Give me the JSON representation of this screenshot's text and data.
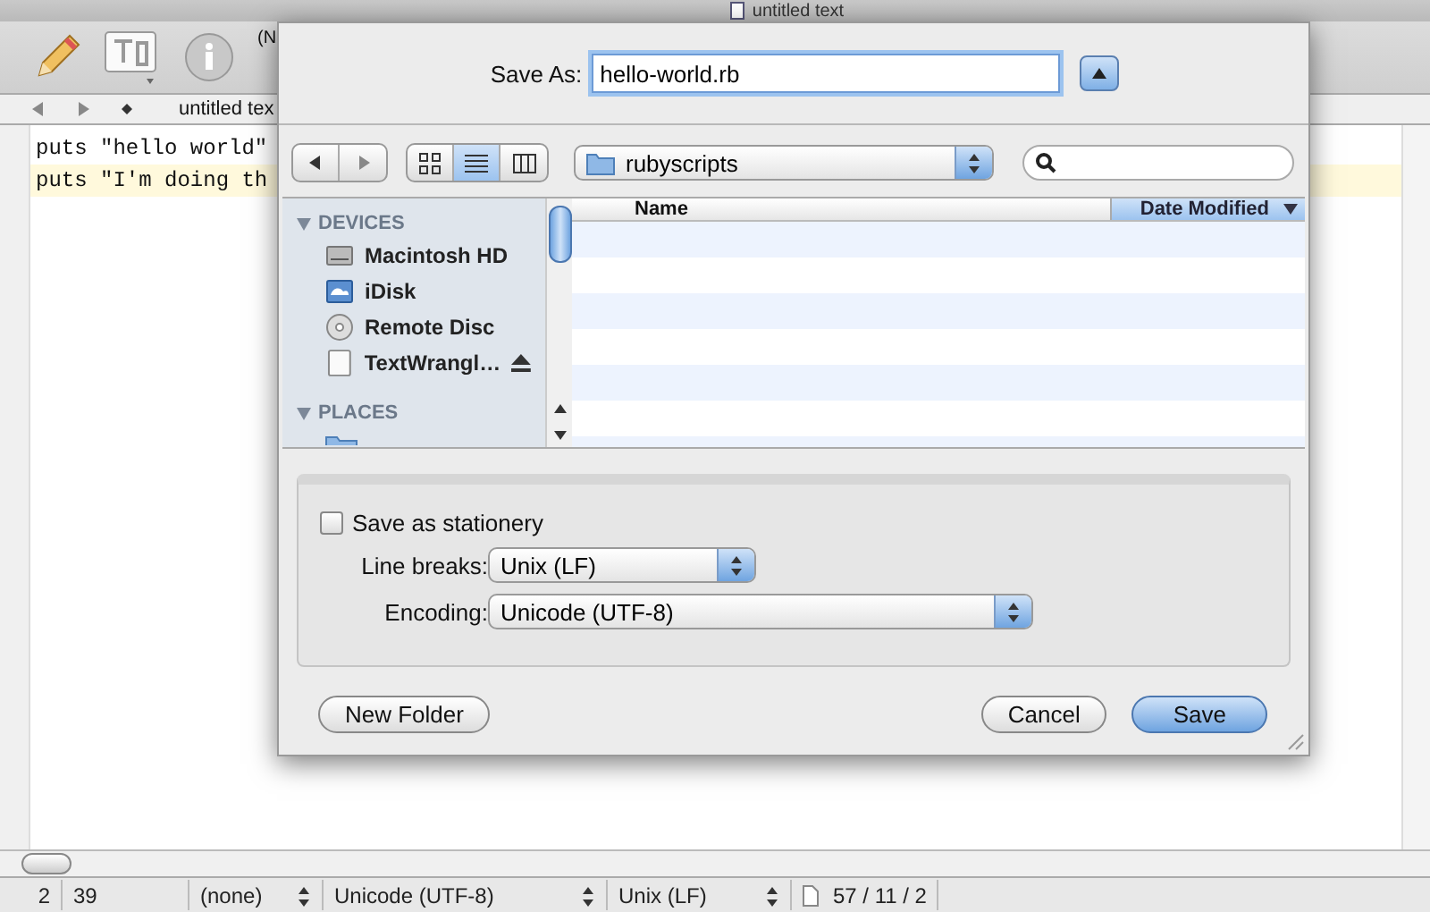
{
  "window": {
    "title": "untitled text",
    "document_label": "(N",
    "tab_title": "untitled tex",
    "lines": [
      {
        "text": "puts \"hello world\"",
        "current": false
      },
      {
        "text": "puts \"I'm doing th",
        "current": true
      }
    ]
  },
  "status_bar": {
    "line": "2",
    "column": "39",
    "language": "(none)",
    "encoding": "Unicode (UTF-8)",
    "line_breaks": "Unix (LF)",
    "counts": "57 / 11 / 2"
  },
  "save_sheet": {
    "save_as_label": "Save As:",
    "file_name": "hello-world.rb",
    "expanded": true,
    "view_modes": [
      {
        "kind": "icon",
        "selected": false
      },
      {
        "kind": "list",
        "selected": true
      },
      {
        "kind": "column",
        "selected": false
      }
    ],
    "location": "rubyscripts",
    "sidebar": [
      {
        "heading": "DEVICES",
        "expanded": true,
        "items": [
          {
            "label": "Macintosh HD",
            "kind": "harddisk",
            "ejectable": false
          },
          {
            "label": "iDisk",
            "kind": "idisk",
            "ejectable": false
          },
          {
            "label": "Remote Disc",
            "kind": "disc",
            "ejectable": false
          },
          {
            "label": "TextWrangl…",
            "kind": "volume",
            "ejectable": true
          }
        ]
      },
      {
        "heading": "PLACES",
        "expanded": true
      }
    ],
    "columns": [
      {
        "label": "Name",
        "selected": false
      },
      {
        "label": "Date Modified",
        "selected": true
      }
    ],
    "stationery": {
      "label": "Save as stationery",
      "checked": false
    },
    "options": [
      {
        "label": "Line breaks:",
        "value": "Unix (LF)"
      },
      {
        "label": "Encoding:",
        "value": "Unicode (UTF-8)"
      }
    ],
    "buttons": [
      {
        "label": "New Folder",
        "default": false,
        "kind": "left"
      },
      {
        "label": "Cancel",
        "default": false,
        "kind": "right"
      },
      {
        "label": "Save",
        "default": true,
        "kind": "right"
      }
    ]
  }
}
